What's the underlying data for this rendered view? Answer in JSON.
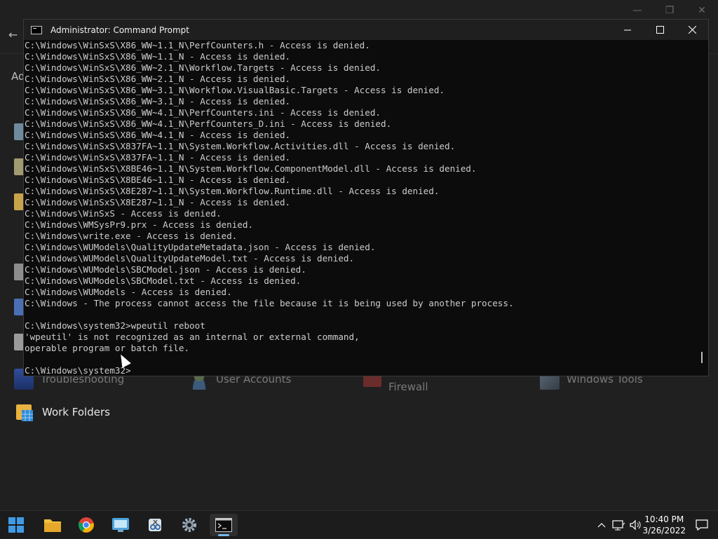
{
  "background_window": {
    "address_text": "Ad",
    "items": [
      {
        "label": "Troubleshooting",
        "dim": true
      },
      {
        "label": "User Accounts",
        "dim": true
      },
      {
        "label": "Firewall",
        "dim": true
      },
      {
        "label": "Windows Tools",
        "dim": true
      },
      {
        "label": "Work Folders",
        "dim": false
      }
    ]
  },
  "cmd_window": {
    "title": "Administrator: Command Prompt",
    "lines": [
      "C:\\Windows\\WinSxS\\X86_WW~1.1_N\\PerfCounters.h - Access is denied.",
      "C:\\Windows\\WinSxS\\X86_WW~1.1_N - Access is denied.",
      "C:\\Windows\\WinSxS\\X86_WW~2.1_N\\Workflow.Targets - Access is denied.",
      "C:\\Windows\\WinSxS\\X86_WW~2.1_N - Access is denied.",
      "C:\\Windows\\WinSxS\\X86_WW~3.1_N\\Workflow.VisualBasic.Targets - Access is denied.",
      "C:\\Windows\\WinSxS\\X86_WW~3.1_N - Access is denied.",
      "C:\\Windows\\WinSxS\\X86_WW~4.1_N\\PerfCounters.ini - Access is denied.",
      "C:\\Windows\\WinSxS\\X86_WW~4.1_N\\PerfCounters_D.ini - Access is denied.",
      "C:\\Windows\\WinSxS\\X86_WW~4.1_N - Access is denied.",
      "C:\\Windows\\WinSxS\\X837FA~1.1_N\\System.Workflow.Activities.dll - Access is denied.",
      "C:\\Windows\\WinSxS\\X837FA~1.1_N - Access is denied.",
      "C:\\Windows\\WinSxS\\X8BE46~1.1_N\\System.Workflow.ComponentModel.dll - Access is denied.",
      "C:\\Windows\\WinSxS\\X8BE46~1.1_N - Access is denied.",
      "C:\\Windows\\WinSxS\\X8E287~1.1_N\\System.Workflow.Runtime.dll - Access is denied.",
      "C:\\Windows\\WinSxS\\X8E287~1.1_N - Access is denied.",
      "C:\\Windows\\WinSxS - Access is denied.",
      "C:\\Windows\\WMSysPr9.prx - Access is denied.",
      "C:\\Windows\\write.exe - Access is denied.",
      "C:\\Windows\\WUModels\\QualityUpdateMetadata.json - Access is denied.",
      "C:\\Windows\\WUModels\\QualityUpdateModel.txt - Access is denied.",
      "C:\\Windows\\WUModels\\SBCModel.json - Access is denied.",
      "C:\\Windows\\WUModels\\SBCModel.txt - Access is denied.",
      "C:\\Windows\\WUModels - Access is denied.",
      "C:\\Windows - The process cannot access the file because it is being used by another process.",
      "",
      "C:\\Windows\\system32>wpeutil reboot",
      "'wpeutil' is not recognized as an internal or external command,",
      "operable program or batch file.",
      "",
      "C:\\Windows\\system32>"
    ]
  },
  "taskbar": {
    "apps": [
      "start-button",
      "file-explorer",
      "chrome",
      "control-panel",
      "snipping-tool",
      "settings",
      "command-prompt"
    ],
    "active_app": "command-prompt",
    "time": "10:40 PM",
    "date": "3/26/2022"
  },
  "colors": {
    "accent": "#76b9ed",
    "terminal_text": "#cccccc",
    "terminal_bg": "#0c0c0c"
  }
}
